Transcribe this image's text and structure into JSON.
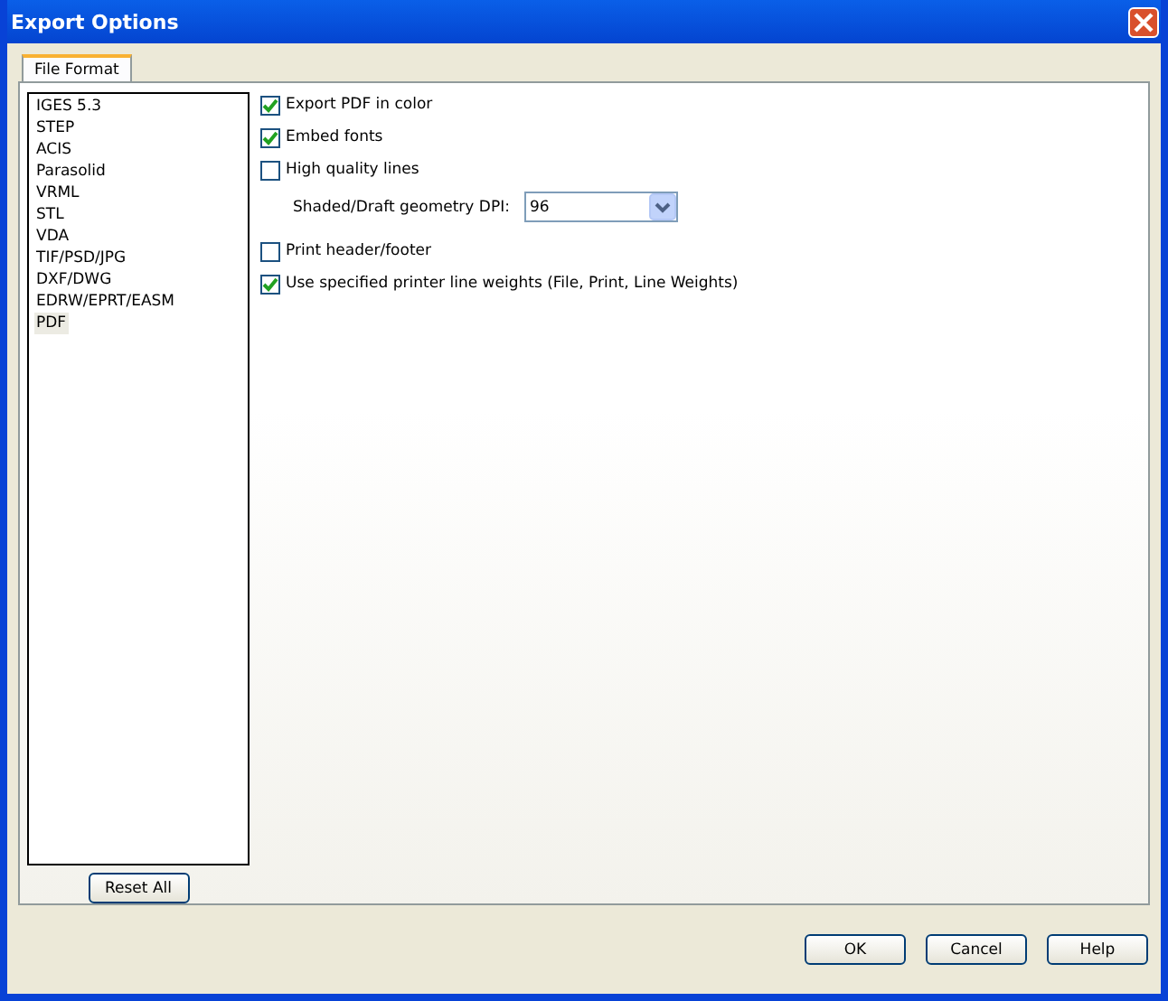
{
  "window": {
    "title": "Export Options"
  },
  "tabs": [
    {
      "label": "File Format",
      "selected": true
    }
  ],
  "formats": [
    {
      "label": "IGES 5.3",
      "selected": false
    },
    {
      "label": "STEP",
      "selected": false
    },
    {
      "label": "ACIS",
      "selected": false
    },
    {
      "label": "Parasolid",
      "selected": false
    },
    {
      "label": "VRML",
      "selected": false
    },
    {
      "label": "STL",
      "selected": false
    },
    {
      "label": "VDA",
      "selected": false
    },
    {
      "label": "TIF/PSD/JPG",
      "selected": false
    },
    {
      "label": "DXF/DWG",
      "selected": false
    },
    {
      "label": "EDRW/EPRT/EASM",
      "selected": false
    },
    {
      "label": "PDF",
      "selected": true
    }
  ],
  "reset_button": "Reset All",
  "options": [
    {
      "kind": "checkbox",
      "label": "Export PDF in color",
      "checked": true
    },
    {
      "kind": "checkbox",
      "label": "Embed fonts",
      "checked": true
    },
    {
      "kind": "checkbox",
      "label": "High quality lines",
      "checked": false
    },
    {
      "kind": "dropdown",
      "label": "Shaded/Draft geometry DPI:",
      "value": "96"
    },
    {
      "kind": "checkbox",
      "label": "Print header/footer",
      "checked": false
    },
    {
      "kind": "checkbox",
      "label": "Use specified printer line weights (File, Print, Line Weights)",
      "checked": true
    }
  ],
  "buttons": [
    "OK",
    "Cancel",
    "Help"
  ]
}
